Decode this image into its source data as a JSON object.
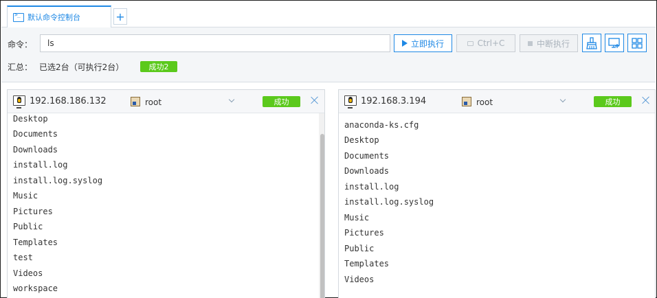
{
  "tabs": [
    {
      "label": "默认命令控制台",
      "icon": "terminal-icon"
    }
  ],
  "tab_add_label": "+",
  "command": {
    "label": "命令：",
    "value": "ls",
    "run_label": "立即执行",
    "ctrlc_label": "Ctrl+C",
    "stop_label": "中断执行"
  },
  "summary": {
    "label": "汇总：",
    "text": "已选2台（可执行2台）",
    "badge": "成功2"
  },
  "sessions": [
    {
      "host": "192.168.186.132",
      "user": "root",
      "status": "成功",
      "output": [
        "Desktop",
        "Documents",
        "Downloads",
        "install.log",
        "install.log.syslog",
        "Music",
        "Pictures",
        "Public",
        "Templates",
        "test",
        "Videos",
        "workspace"
      ]
    },
    {
      "host": "192.168.3.194",
      "user": "root",
      "status": "成功",
      "output": [
        "anaconda-ks.cfg",
        "Desktop",
        "Documents",
        "Downloads",
        "install.log",
        "install.log.syslog",
        "Music",
        "Pictures",
        "Public",
        "Templates",
        "Videos"
      ]
    }
  ],
  "colors": {
    "accent": "#1e88e5",
    "success": "#5bc91c"
  }
}
